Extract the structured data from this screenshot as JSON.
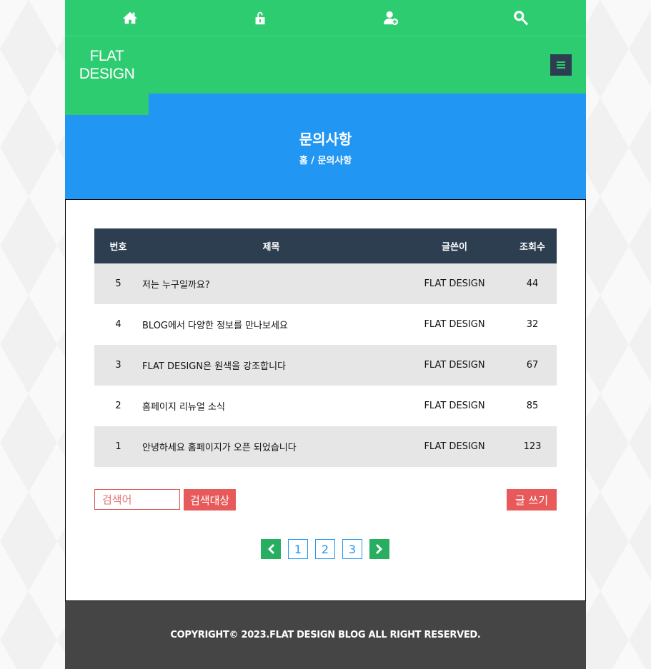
{
  "top_nav": {
    "items": [
      {
        "icon": "home-icon"
      },
      {
        "icon": "unlock-icon"
      },
      {
        "icon": "user-add-icon"
      },
      {
        "icon": "search-icon"
      }
    ],
    "color": "#2ecc71"
  },
  "header": {
    "logo_line1": "FLAT",
    "logo_line2": "DESIGN",
    "menu_icon": "hamburger-menu-icon"
  },
  "banner": {
    "title": "문의사항",
    "breadcrumb": "홈 / 문의사항",
    "color": "#2196f3"
  },
  "board": {
    "headers": {
      "num": "번호",
      "title": "제목",
      "writer": "글쓴이",
      "views": "조회수"
    },
    "rows": [
      {
        "num": "5",
        "title": "저는 누구일까요?",
        "writer": "FLAT DESIGN",
        "views": "44"
      },
      {
        "num": "4",
        "title": "BLOG에서 다양한 정보를 만나보세요",
        "writer": "FLAT DESIGN",
        "views": "32"
      },
      {
        "num": "3",
        "title": "FLAT DESIGN은 원색을 강조합니다",
        "writer": "FLAT DESIGN",
        "views": "67"
      },
      {
        "num": "2",
        "title": "홈페이지 리뉴얼 소식",
        "writer": "FLAT DESIGN",
        "views": "85"
      },
      {
        "num": "1",
        "title": "안녕하세요 홈페이지가 오픈 되었습니다",
        "writer": "FLAT DESIGN",
        "views": "123"
      }
    ]
  },
  "search": {
    "placeholder": "검색어",
    "button_label": "검색대상"
  },
  "write_button": "글 쓰기",
  "pagination": {
    "pages": [
      "1",
      "2",
      "3"
    ],
    "prev_icon": "chevron-left-icon",
    "next_icon": "chevron-right-icon"
  },
  "footer": {
    "copyright": "COPYRIGHT© 2023.FLAT DESIGN BLOG ALL RIGHT RESERVED."
  }
}
